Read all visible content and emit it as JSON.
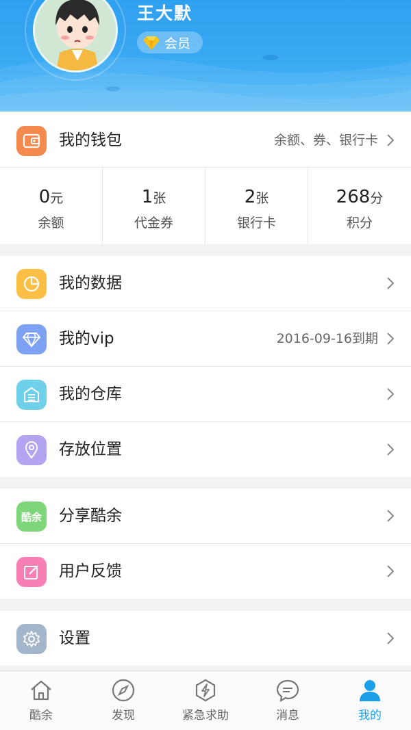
{
  "profile": {
    "username": "王大默",
    "member_label": "会员"
  },
  "wallet": {
    "label": "我的钱包",
    "extra": "余额、券、银行卡",
    "icon": "wallet-icon",
    "color": "#f58a4e"
  },
  "stats": [
    {
      "value": "0",
      "unit": "元",
      "name": "余额"
    },
    {
      "value": "1",
      "unit": "张",
      "name": "代金券"
    },
    {
      "value": "2",
      "unit": "张",
      "name": "银行卡"
    },
    {
      "value": "268",
      "unit": "分",
      "name": "积分"
    }
  ],
  "menu": {
    "data": {
      "label": "我的数据",
      "icon": "pie-chart-icon",
      "color": "#fbbf45"
    },
    "vip": {
      "label": "我的vip",
      "extra": "2016-09-16到期",
      "icon": "diamond-icon",
      "color": "#7ea2f3"
    },
    "warehouse": {
      "label": "我的仓库",
      "icon": "warehouse-icon",
      "color": "#6fd0ea"
    },
    "location": {
      "label": "存放位置",
      "icon": "location-pin-icon",
      "color": "#b4a4ef"
    },
    "share": {
      "label": "分享酷余",
      "icon": "share-icon",
      "icon_text": "酷余",
      "color": "#7fd67a"
    },
    "feedback": {
      "label": "用户反馈",
      "icon": "edit-icon",
      "color": "#f77fb4"
    },
    "settings": {
      "label": "设置",
      "icon": "gear-icon",
      "color": "#a3b6cc"
    }
  },
  "tabs": [
    {
      "label": "酷余",
      "icon": "home-icon",
      "active": false
    },
    {
      "label": "发现",
      "icon": "compass-icon",
      "active": false
    },
    {
      "label": "紧急求助",
      "icon": "emergency-icon",
      "active": false
    },
    {
      "label": "消息",
      "icon": "chat-bubble-icon",
      "active": false
    },
    {
      "label": "我的",
      "icon": "user-icon",
      "active": true
    }
  ],
  "colors": {
    "header_blue": "#36a6f2",
    "active_tab": "#1aa0e8"
  }
}
